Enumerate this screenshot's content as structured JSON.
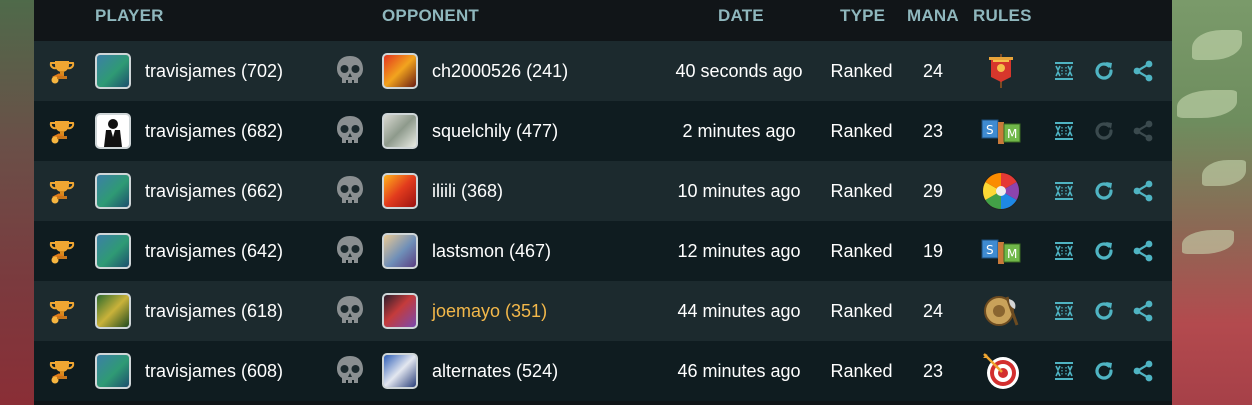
{
  "header": {
    "player": "PLAYER",
    "opponent": "OPPONENT",
    "date": "DATE",
    "type": "TYPE",
    "mana": "MANA",
    "rules": "RULES"
  },
  "colors": {
    "header_text": "#8fb7bd",
    "action_enabled": "#4fb4c3",
    "action_disabled": "#3b4a4e",
    "highlight_name": "#f3b84a"
  },
  "rows": [
    {
      "player": "travisjames (702)",
      "opponent": "ch2000526 (241)",
      "date": "40 seconds ago",
      "type": "Ranked",
      "mana": "24",
      "rule_icon": "banner-flag-icon",
      "replay_enabled": true,
      "share_enabled": true,
      "opponent_highlight": false
    },
    {
      "player": "travisjames (682)",
      "opponent": "squelchily (477)",
      "date": "2 minutes ago",
      "type": "Ranked",
      "mana": "23",
      "rule_icon": "blocks-icon",
      "replay_enabled": false,
      "share_enabled": false,
      "opponent_highlight": false
    },
    {
      "player": "travisjames (662)",
      "opponent": "iliili (368)",
      "date": "10 minutes ago",
      "type": "Ranked",
      "mana": "29",
      "rule_icon": "color-wheel-icon",
      "replay_enabled": true,
      "share_enabled": true,
      "opponent_highlight": false
    },
    {
      "player": "travisjames (642)",
      "opponent": "lastsmon (467)",
      "date": "12 minutes ago",
      "type": "Ranked",
      "mana": "19",
      "rule_icon": "blocks-icon",
      "replay_enabled": true,
      "share_enabled": true,
      "opponent_highlight": false
    },
    {
      "player": "travisjames (618)",
      "opponent": "joemayo (351)",
      "date": "44 minutes ago",
      "type": "Ranked",
      "mana": "24",
      "rule_icon": "shield-axe-icon",
      "replay_enabled": true,
      "share_enabled": true,
      "opponent_highlight": true
    },
    {
      "player": "travisjames (608)",
      "opponent": "alternates (524)",
      "date": "46 minutes ago",
      "type": "Ranked",
      "mana": "23",
      "rule_icon": "target-icon",
      "replay_enabled": true,
      "share_enabled": true,
      "opponent_highlight": false
    }
  ]
}
